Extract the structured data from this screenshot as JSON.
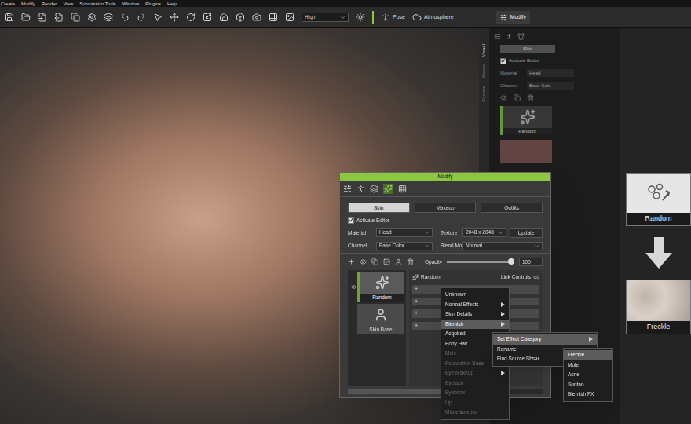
{
  "menu_bar": [
    {
      "label": "Create"
    },
    {
      "label": "Modify"
    },
    {
      "label": "Render"
    },
    {
      "label": "View"
    },
    {
      "label": "Submission Tools"
    },
    {
      "label": "Window"
    },
    {
      "label": "Plugins"
    },
    {
      "label": "Help"
    }
  ],
  "toolbar": {
    "quality": "High",
    "buttons": [
      "Pose",
      "Atmosphere"
    ],
    "panel_tabs": [
      {
        "label": "Modify",
        "selected": true
      }
    ]
  },
  "side_panel": {
    "vertical_tabs": [
      {
        "label": "Visual",
        "selected": true
      },
      {
        "label": "Scene",
        "selected": false
      },
      {
        "label": "Content",
        "selected": false
      }
    ],
    "tabs": [
      {
        "label": "Skin",
        "selected": true
      }
    ],
    "activate_editor": {
      "label": "Activate Editor",
      "checked": true
    },
    "fields": [
      {
        "label": "Material",
        "value": "Head"
      },
      {
        "label": "Channel",
        "value": "Base Colo"
      }
    ],
    "layers": [
      {
        "label": "Random",
        "selected": true
      }
    ]
  },
  "modify_window": {
    "title": "Modify",
    "tabs": [
      {
        "label": "Skin",
        "selected": true
      },
      {
        "label": "Makeup",
        "selected": false
      },
      {
        "label": "Outfits",
        "selected": false
      }
    ],
    "activate_editor": {
      "label": "Activate Editor",
      "checked": true
    },
    "material": {
      "label": "Material",
      "value": "Head"
    },
    "texture": {
      "label": "Texture",
      "value": "2048 x 2048"
    },
    "update_button": "Update",
    "channel": {
      "label": "Channel",
      "value": "Base Color"
    },
    "blend_mode": {
      "label": "Blend Mode",
      "value": "Normal"
    },
    "opacity": {
      "label": "Opacity",
      "level": 1,
      "reading": "100"
    },
    "layers": [
      {
        "label": "Random",
        "selected": true,
        "visible": true
      },
      {
        "label": "Skin Base",
        "selected": false,
        "visible": false
      }
    ],
    "effect_header": {
      "title": "Random",
      "link_label": "Link Controls"
    },
    "effect_rows": [
      "+",
      "+",
      "+",
      "+"
    ]
  },
  "context_menu": [
    {
      "label": "Unknown",
      "submenu": false,
      "disabled": false,
      "selected": false
    },
    {
      "label": "Normal Effects",
      "submenu": true,
      "disabled": false,
      "selected": false
    },
    {
      "label": "Skin Details",
      "submenu": true,
      "disabled": false,
      "selected": false
    },
    {
      "label": "Blemish",
      "submenu": true,
      "disabled": false,
      "selected": true
    },
    {
      "label": "Acquired",
      "submenu": false,
      "disabled": false,
      "selected": false
    },
    {
      "label": "Body Hair",
      "submenu": false,
      "disabled": false,
      "selected": false
    },
    {
      "label": "Mole",
      "submenu": false,
      "disabled": true,
      "selected": false
    },
    {
      "label": "Foundation Base",
      "submenu": false,
      "disabled": true,
      "selected": false
    },
    {
      "label": "Eye Makeup",
      "submenu": true,
      "disabled": true,
      "selected": false
    },
    {
      "label": "Eyelash",
      "submenu": false,
      "disabled": true,
      "selected": false
    },
    {
      "label": "Eyebrow",
      "submenu": false,
      "disabled": true,
      "selected": false
    },
    {
      "label": "Lip",
      "submenu": false,
      "disabled": true,
      "selected": false
    },
    {
      "label": "Miscellaneous",
      "submenu": false,
      "disabled": true,
      "selected": false
    }
  ],
  "layer_menu": [
    {
      "label": "Set Effect Category",
      "submenu": true,
      "disabled": false,
      "selected": true
    },
    {
      "label": "Rename",
      "submenu": false,
      "disabled": false,
      "selected": false
    },
    {
      "label": "Find Source Sbsar",
      "submenu": false,
      "disabled": false,
      "selected": false
    }
  ],
  "category_menu": [
    {
      "label": "Freckle",
      "submenu": false,
      "disabled": false,
      "selected": true
    },
    {
      "label": "Mole",
      "submenu": false,
      "disabled": false,
      "selected": false
    },
    {
      "label": "Acne",
      "submenu": false,
      "disabled": false,
      "selected": false
    },
    {
      "label": "Suntan",
      "submenu": false,
      "disabled": false,
      "selected": false
    },
    {
      "label": "Blemish FX",
      "submenu": false,
      "disabled": false,
      "selected": false
    }
  ],
  "diagram": {
    "from": "Random",
    "to": "Freckle"
  }
}
